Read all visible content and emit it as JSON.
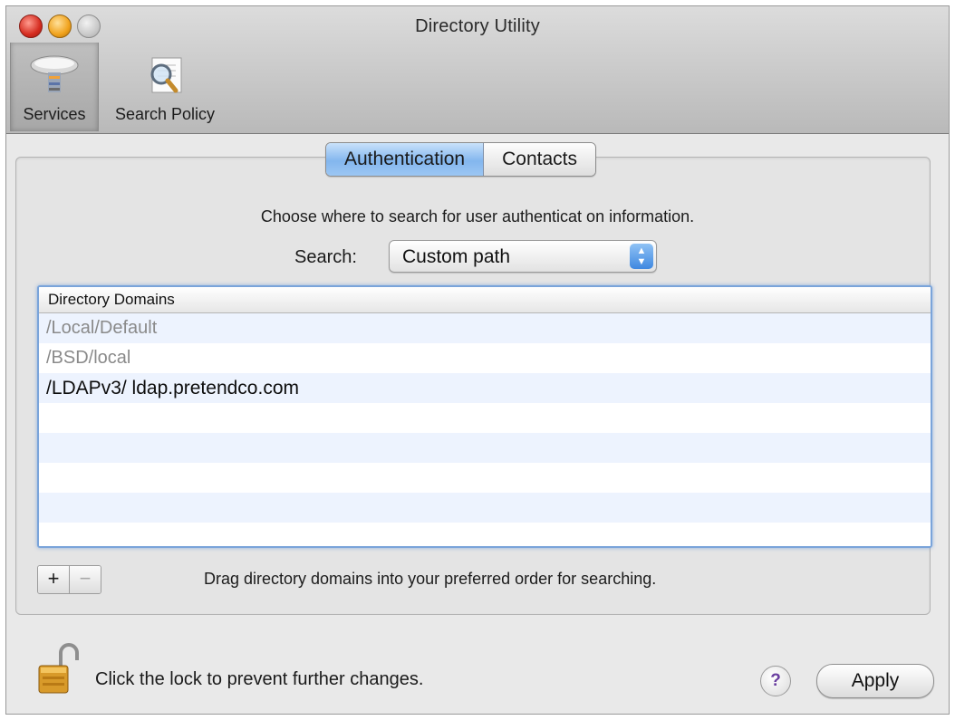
{
  "window": {
    "title": "Directory Utility"
  },
  "toolbar": {
    "items": [
      {
        "label": "Services",
        "icon": "services-icon",
        "selected": true
      },
      {
        "label": "Search Policy",
        "icon": "search-policy-icon",
        "selected": false
      }
    ]
  },
  "tabs": [
    {
      "label": "Authentication",
      "active": true
    },
    {
      "label": "Contacts",
      "active": false
    }
  ],
  "panel": {
    "instruction": "Choose where to search for user authenticat on information.",
    "search_label": "Search:",
    "search_value": "Custom path",
    "table": {
      "header": "Directory Domains",
      "rows": [
        {
          "label": "/Local/Default",
          "enabled": false
        },
        {
          "label": "/BSD/local",
          "enabled": false
        },
        {
          "label": "/LDAPv3/ ldap.pretendco.com",
          "enabled": true
        },
        {
          "label": ""
        },
        {
          "label": ""
        },
        {
          "label": ""
        },
        {
          "label": ""
        },
        {
          "label": ""
        }
      ]
    },
    "add_label": "+",
    "remove_label": "−",
    "hint": "Drag directory domains into your preferred order for searching."
  },
  "footer": {
    "lock_text": "Click the lock to prevent further changes.",
    "help_label": "?",
    "apply_label": "Apply"
  },
  "colors": {
    "accent": "#83b6ee",
    "selection_border": "#7aa4da",
    "row_alt": "#edf3fe"
  }
}
